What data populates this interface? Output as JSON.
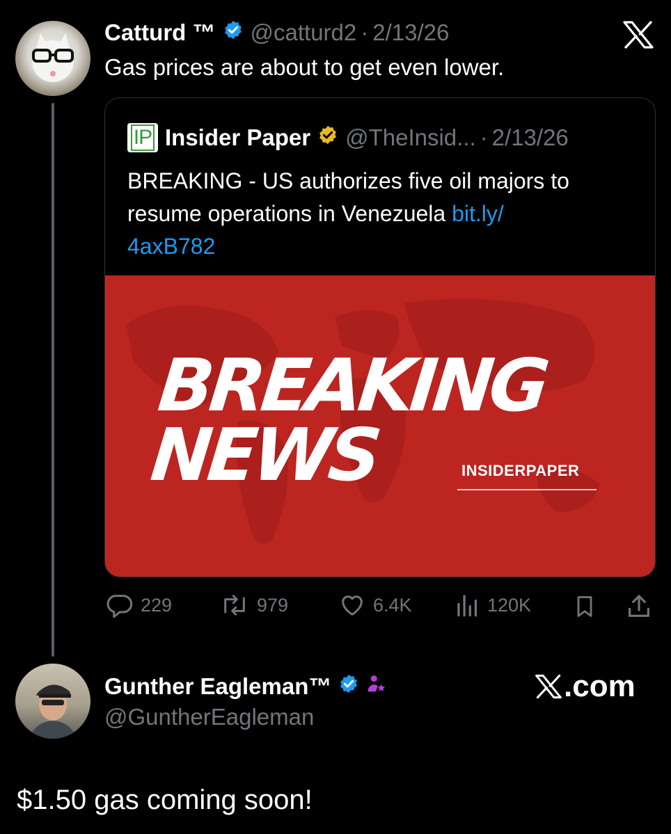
{
  "tweet": {
    "author_name": "Catturd ™",
    "handle": "@catturd2",
    "separator": "·",
    "date": "2/13/26",
    "text": "Gas prices are about to get even lower."
  },
  "quote": {
    "logo_text": "IP",
    "author_name": "Insider Paper",
    "handle": "@TheInsid...",
    "separator": "·",
    "date": "2/13/26",
    "text": "BREAKING - US authorizes five oil majors to resume operations in Venezuela",
    "link_line1": "bit.ly/",
    "link_line2": "4axB782",
    "image": {
      "headline_line1": "BREAKING",
      "headline_line2": "NEWS",
      "brand": "INSIDERPAPER"
    }
  },
  "actions": {
    "replies": "229",
    "reposts": "979",
    "likes": "6.4K",
    "views": "120K"
  },
  "reply": {
    "author_name": "Gunther Eagleman™",
    "handle": "@GuntherEagleman",
    "text": "$1.50 gas coming soon!",
    "watermark": "X.com"
  },
  "colors": {
    "background": "#000000",
    "verified_blue": "#1d9bf0",
    "verified_gold": "#e8b829",
    "link": "#1d9bf0",
    "breaking_red": "#bd2521",
    "muted": "#71767b",
    "subscriber_purple": "#b43fd8"
  },
  "icons": [
    "x-logo-icon",
    "verified-blue-icon",
    "verified-gold-icon",
    "reply-icon",
    "repost-icon",
    "like-icon",
    "views-icon",
    "bookmark-icon",
    "share-icon",
    "subscriber-icon"
  ]
}
